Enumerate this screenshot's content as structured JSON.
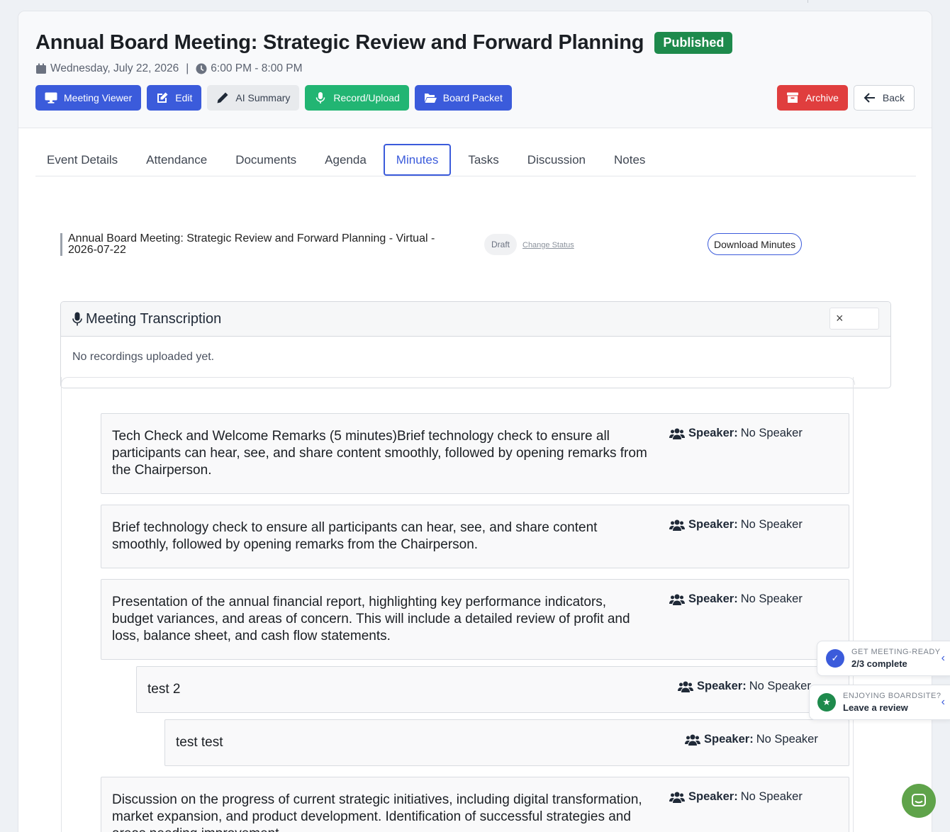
{
  "meeting": {
    "title": "Annual Board Meeting: Strategic Review and Forward Planning",
    "status": "Published",
    "date": "Wednesday, July 22, 2026",
    "separator": "|",
    "time": "6:00 PM - 8:00 PM"
  },
  "toolbar": {
    "meeting_viewer": "Meeting Viewer",
    "edit": "Edit",
    "ai_summary": "AI Summary",
    "record_upload": "Record/Upload",
    "board_packet": "Board Packet",
    "archive": "Archive",
    "back": "Back"
  },
  "tabs": [
    "Event Details",
    "Attendance",
    "Documents",
    "Agenda",
    "Minutes",
    "Tasks",
    "Discussion",
    "Notes"
  ],
  "active_tab": "Minutes",
  "minutes": {
    "title": "Annual Board Meeting: Strategic Review and Forward Planning - Virtual - 2026-07-22",
    "status": "Draft",
    "change_status": "Change Status",
    "download": "Download Minutes"
  },
  "transcription": {
    "title": "Meeting Transcription",
    "close": "×",
    "empty": "No recordings uploaded yet."
  },
  "speaker_label": "Speaker:",
  "items": [
    {
      "text": "Tech Check and Welcome Remarks (5 minutes)Brief technology check to ensure all participants can hear, see, and share content smoothly, followed by opening remarks from the Chairperson.",
      "speaker": "No Speaker"
    },
    {
      "text": "Brief technology check to ensure all participants can hear, see, and share content smoothly, followed by opening remarks from the Chairperson.",
      "speaker": "No Speaker"
    },
    {
      "text": "Presentation of the annual financial report, highlighting key performance indicators, budget variances, and areas of concern. This will include a detailed review of profit and loss, balance sheet, and cash flow statements.",
      "speaker": "No Speaker"
    },
    {
      "text": "test 2",
      "speaker": "No Speaker"
    },
    {
      "text": "test test",
      "speaker": "No Speaker"
    },
    {
      "text": "Discussion on the progress of current strategic initiatives, including digital transformation, market expansion, and product development. Identification of successful strategies and areas needing improvement.",
      "speaker": "No Speaker"
    }
  ],
  "widgets": {
    "ready_label": "GET MEETING-READY",
    "ready_value": "2/3 complete",
    "review_label": "ENJOYING BOARDSITE?",
    "review_value": "Leave a review"
  },
  "colors": {
    "primary": "#3b5bdb",
    "published": "#1e8a4c",
    "record": "#22b573",
    "archive": "#e03e3e",
    "chat": "#5fa34a"
  }
}
